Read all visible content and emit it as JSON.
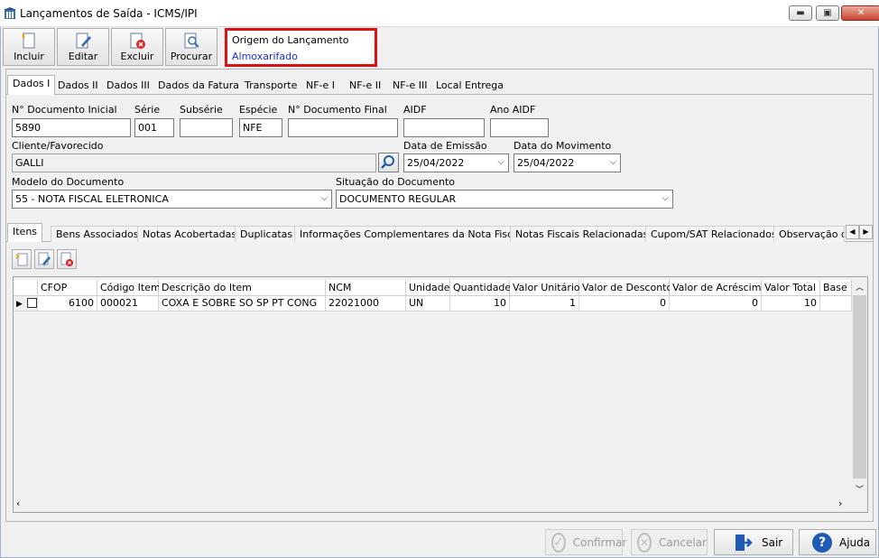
{
  "window": {
    "title": "Lançamentos de Saída - ICMS/IPI"
  },
  "toolbar": {
    "incluir": "Incluir",
    "editar": "Editar",
    "excluir": "Excluir",
    "procurar": "Procurar"
  },
  "origem": {
    "label": "Origem do Lançamento",
    "value": "Almoxarifado"
  },
  "tabs": [
    "Dados I",
    "Dados II",
    "Dados III",
    "Dados da Fatura",
    "Transporte",
    "NF-e I",
    "NF-e II",
    "NF-e III",
    "Local Entrega"
  ],
  "fields": {
    "doc_inicial": {
      "label": "N° Documento Inicial",
      "value": "5890"
    },
    "serie": {
      "label": "Série",
      "value": "001"
    },
    "subserie": {
      "label": "Subsérie",
      "value": ""
    },
    "especie": {
      "label": "Espécie",
      "value": "NFE"
    },
    "doc_final": {
      "label": "N° Documento Final",
      "value": ""
    },
    "aidf": {
      "label": "AIDF",
      "value": ""
    },
    "ano_aidf": {
      "label": "Ano AIDF",
      "value": ""
    },
    "cliente": {
      "label": "Cliente/Favorecido",
      "value": "GALLI"
    },
    "data_emissao": {
      "label": "Data de Emissão",
      "value": "25/04/2022"
    },
    "data_movimento": {
      "label": "Data do Movimento",
      "value": "25/04/2022"
    },
    "modelo": {
      "label": "Modelo do Documento",
      "value": "55 - NOTA FISCAL ELETRONICA"
    },
    "situacao": {
      "label": "Situação do Documento",
      "value": "DOCUMENTO REGULAR"
    }
  },
  "inner_tabs": [
    "Itens",
    "Bens Associados",
    "Notas Acobertadas",
    "Duplicatas",
    "Informações Complementares da Nota Fiscal",
    "Notas Fiscais Relacionadas",
    "Cupom/SAT Relacionados",
    "Observação do"
  ],
  "grid": {
    "columns": [
      "CFOP",
      "Código Item",
      "Descrição do Item",
      "NCM",
      "Unidade",
      "Quantidade",
      "Valor Unitário",
      "Valor de Desconto",
      "Valor de Acréscimo",
      "Valor Total",
      "Base d"
    ],
    "rows": [
      [
        "6100",
        "000021",
        "COXA E SOBRE SO SP PT CONG",
        "22021000",
        "UN",
        "10",
        "1",
        "0",
        "0",
        "10",
        ""
      ]
    ]
  },
  "footer": {
    "confirmar": "Confirmar",
    "cancelar": "Cancelar",
    "sair": "Sair",
    "ajuda": "Ajuda"
  },
  "colors": {
    "accent_red": "#e01010",
    "link_blue": "#1a2bd6",
    "help_blue": "#1f5bb5"
  }
}
